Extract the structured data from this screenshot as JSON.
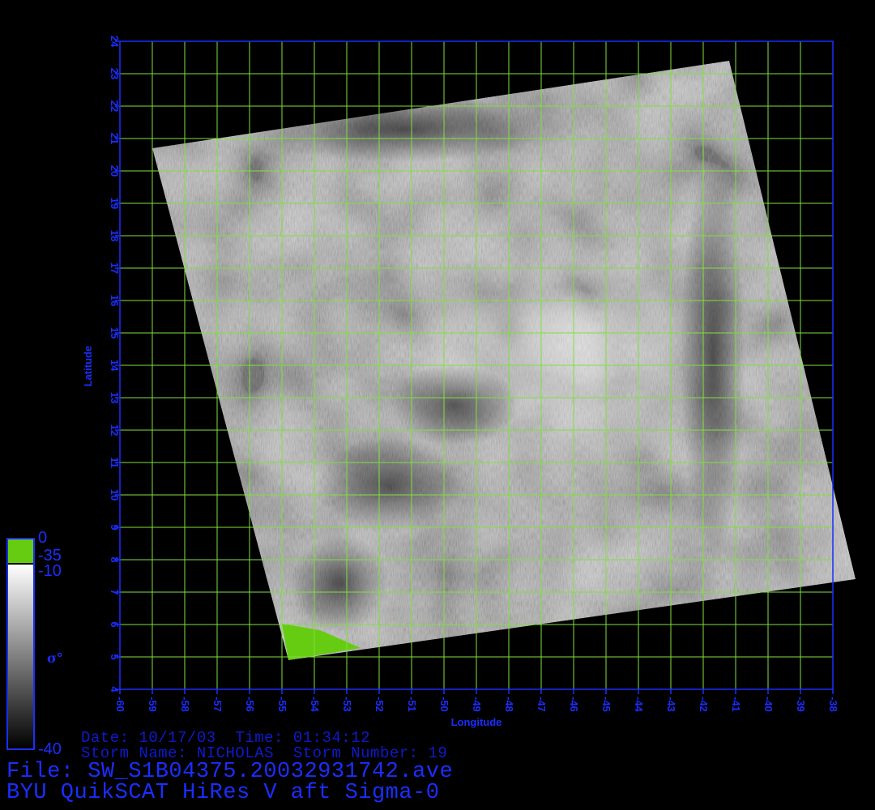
{
  "chart_data": {
    "type": "map",
    "title": "BYU QuikSCAT HiRes V aft Sigma-0",
    "xlabel": "Longitude",
    "ylabel": "Latitude",
    "xlim": [
      -60,
      -38
    ],
    "ylim": [
      4,
      24
    ],
    "x_ticks": [
      "-60",
      "-59",
      "-58",
      "-57",
      "-56",
      "-55",
      "-54",
      "-53",
      "-52",
      "-51",
      "-50",
      "-49",
      "-48",
      "-47",
      "-46",
      "-45",
      "-44",
      "-43",
      "-42",
      "-41",
      "-40",
      "-39",
      "-38"
    ],
    "y_ticks": [
      "4",
      "5",
      "6",
      "7",
      "8",
      "9",
      "10",
      "11",
      "12",
      "13",
      "14",
      "15",
      "16",
      "17",
      "18",
      "19",
      "20",
      "21",
      "22",
      "23",
      "24"
    ],
    "grid": true,
    "grid_color": "#7fdf3f",
    "frame_color": "#1a2eff",
    "swath_corners_lonlat": [
      [
        -59.0,
        20.7
      ],
      [
        -41.2,
        23.4
      ],
      [
        -37.3,
        7.4
      ],
      [
        -54.8,
        4.9
      ]
    ],
    "land_color": "#66cc11",
    "colorbar": {
      "label": "σ°",
      "ticks": [
        "0",
        "-35",
        "-10",
        "-40"
      ],
      "land_color": "#66cc11"
    }
  },
  "info": {
    "date_line": "Date: 10/17/03  Time: 01:34:12",
    "storm_line": "Storm Name: NICHOLAS  Storm Number: 19",
    "file_line": "File: SW_S1B04375.20032931742.ave",
    "title_line": "BYU QuikSCAT HiRes V aft Sigma-0"
  }
}
